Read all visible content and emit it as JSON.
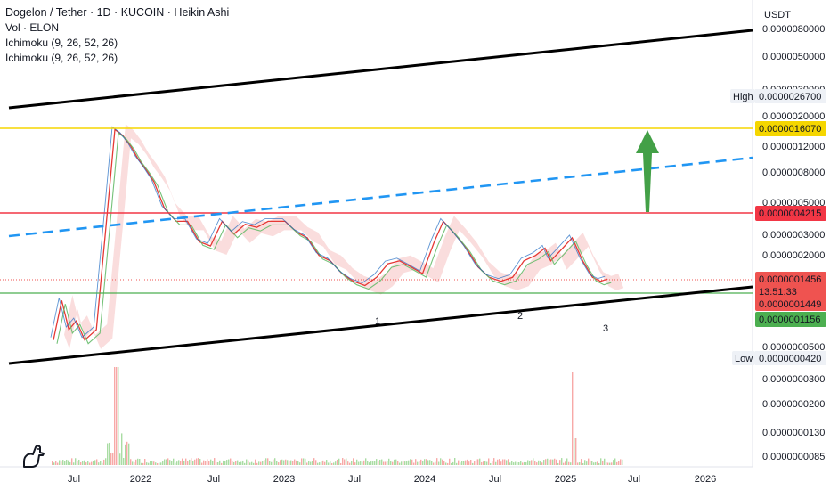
{
  "header": {
    "title": "Dogelon / Tether · 1D · KUCOIN · Heikin Ashi",
    "indicators": [
      "Vol · ELON",
      "Ichimoku (9, 26, 52, 26)",
      "Ichimoku (9, 26, 52, 26)"
    ]
  },
  "price_axis": {
    "unit": "USDT",
    "ticks": [
      "0.0000080000",
      "0.0000050000",
      "0.0000030000",
      "0.0000020000",
      "0.0000012000",
      "0.0000008000",
      "0.0000005000",
      "0.0000003000",
      "0.0000002000",
      "0.0000000500",
      "0.0000000300",
      "0.0000000200",
      "0.0000000130",
      "0.0000000085"
    ],
    "high_label": "High",
    "high_value": "0.0000026700",
    "low_label": "Low",
    "low_value": "0.0000000420",
    "tag_yellow": "0.0000016070",
    "tag_red": "0.0000004215",
    "tag_current": "0.0000001456",
    "tag_countdown": "13:51:33",
    "tag_last": "0.0000001449",
    "tag_green": "0.0000001156"
  },
  "time_axis": {
    "ticks": [
      "Jul",
      "2022",
      "Jul",
      "2023",
      "Jul",
      "2024",
      "Jul",
      "2025",
      "Jul",
      "2026"
    ]
  },
  "annotations": [
    "1",
    "2",
    "3"
  ],
  "colors": {
    "yellow": "#f5d600",
    "red": "#f23645",
    "green": "#4caf50",
    "blue": "#2196f3",
    "arrow": "#43a047",
    "current": "#ef5350",
    "cloud": "#f6c1c1",
    "black": "#000000"
  },
  "chart_data": {
    "type": "line",
    "title": "Dogelon / Tether · 1D · KUCOIN · Heikin Ashi",
    "xlabel": "",
    "ylabel": "USDT",
    "y_scale": "log",
    "series": [
      {
        "x": [
          "2021-05-10",
          "2021-06-01",
          "2021-06-20",
          "2021-07-10",
          "2021-08-01",
          "2021-09-01",
          "2021-10-01",
          "2021-10-20",
          "2021-11-10",
          "2021-12-01",
          "2021-12-20",
          "2022-01-10",
          "2022-02-01",
          "2022-03-01",
          "2022-04-01",
          "2022-05-01",
          "2022-06-01",
          "2022-07-01",
          "2022-08-01",
          "2022-09-01",
          "2022-10-01",
          "2022-11-01",
          "2022-12-01",
          "2023-01-15",
          "2023-02-15",
          "2023-03-15",
          "2023-04-15",
          "2023-05-15",
          "2023-06-15",
          "2023-07-15",
          "2023-08-15",
          "2023-09-15",
          "2023-10-15",
          "2023-11-15",
          "2023-12-15",
          "2024-01-15",
          "2024-02-15",
          "2024-03-10",
          "2024-04-10",
          "2024-05-10",
          "2024-06-10",
          "2024-07-10",
          "2024-08-10",
          "2024-09-10",
          "2024-10-10",
          "2024-11-10",
          "2024-12-05",
          "2024-12-20",
          "2025-01-15",
          "2025-02-15",
          "2025-03-15",
          "2025-04-10",
          "2025-05-01",
          "2025-05-20"
        ],
        "values": [
          5e-08,
          1e-07,
          6e-08,
          7e-08,
          5e-08,
          6e-08,
          5e-07,
          2e-06,
          1.8e-06,
          1.5e-06,
          1.2e-06,
          1e-06,
          8e-07,
          5e-07,
          4e-07,
          4e-07,
          2.8e-07,
          2.6e-07,
          4e-07,
          3.2e-07,
          3.8e-07,
          3.6e-07,
          4e-07,
          4e-07,
          3.3e-07,
          3e-07,
          2.2e-07,
          2e-07,
          1.6e-07,
          1.4e-07,
          1.3e-07,
          1.5e-07,
          1.9e-07,
          2e-07,
          1.8e-07,
          1.6e-07,
          2.8e-07,
          4e-07,
          3.2e-07,
          2.5e-07,
          1.8e-07,
          1.5e-07,
          1.4e-07,
          1.5e-07,
          2e-07,
          2.2e-07,
          2.5e-07,
          2e-07,
          2.4e-07,
          3e-07,
          2e-07,
          1.5e-07,
          1.4e-07,
          1.456e-07
        ]
      }
    ],
    "ylim": [
      4e-08,
      1.1e-05
    ],
    "grid": false,
    "legend": "top-left"
  }
}
